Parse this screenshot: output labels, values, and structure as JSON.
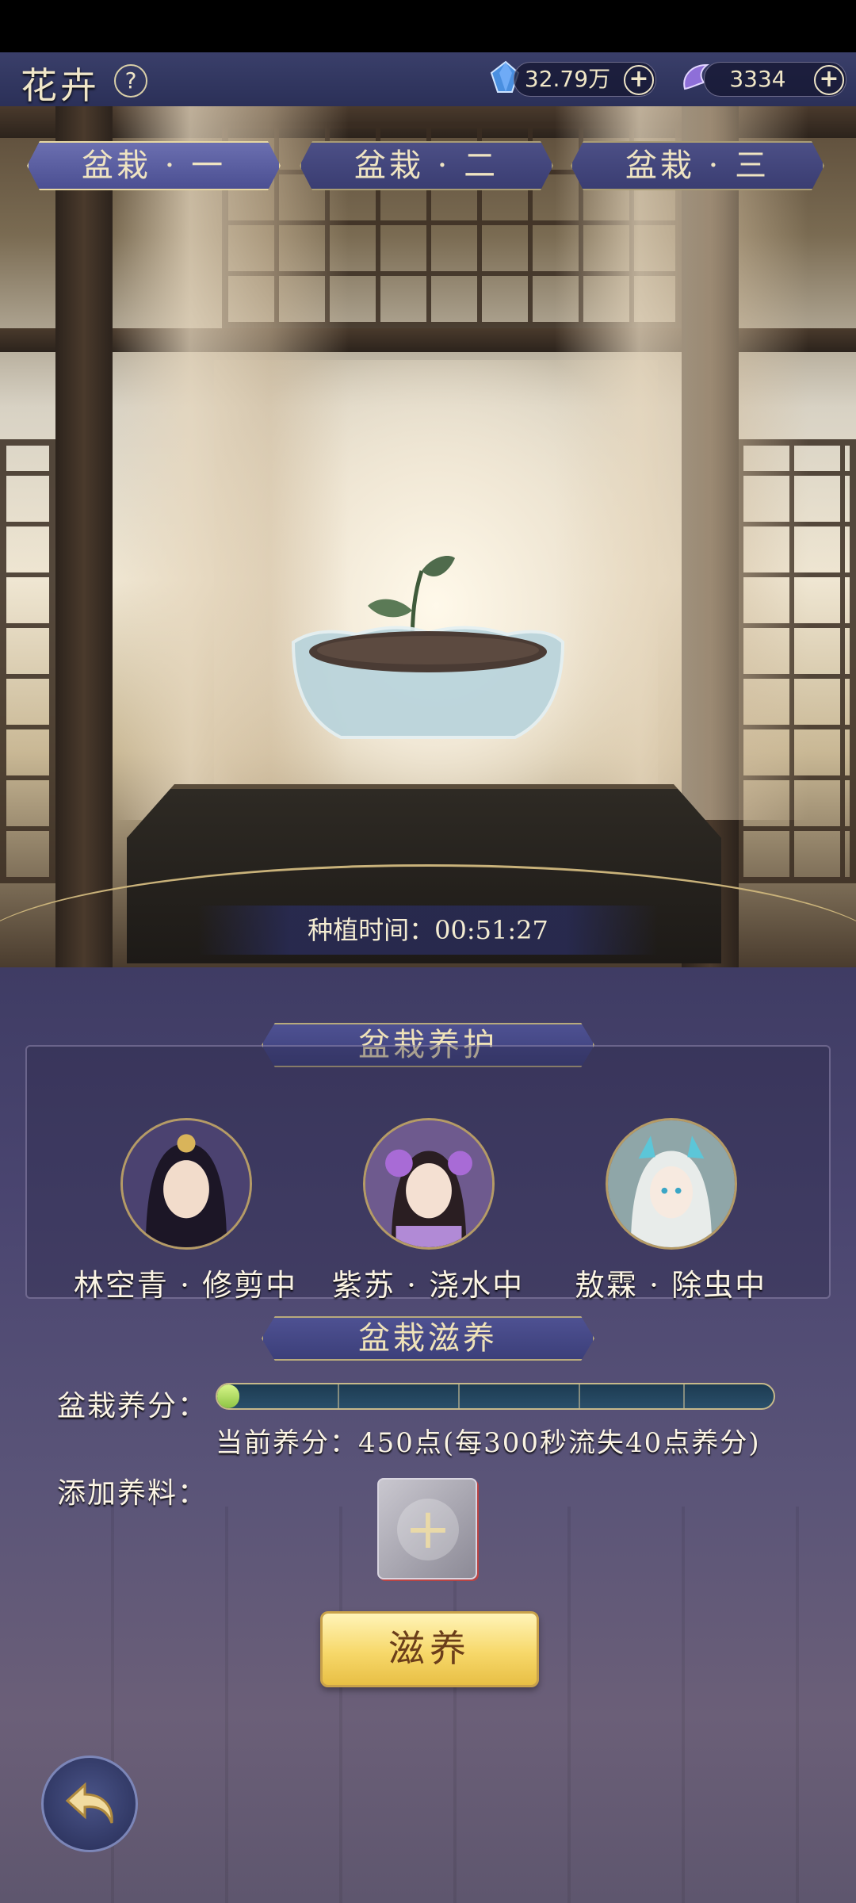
{
  "header": {
    "title": "花卉",
    "help_icon": "question-icon",
    "currency_1": {
      "icon": "blue-crystal-icon",
      "value": "32.79万"
    },
    "currency_2": {
      "icon": "purple-jade-icon",
      "value": "3334"
    }
  },
  "tabs": [
    {
      "label": "盆栽 · 一",
      "active": true
    },
    {
      "label": "盆栽 · 二",
      "active": false
    },
    {
      "label": "盆栽 · 三",
      "active": false
    }
  ],
  "scene": {
    "plant_time": "种植时间：00:51:27"
  },
  "care": {
    "title": "盆栽养护",
    "characters": [
      {
        "label": "林空青 · 修剪中"
      },
      {
        "label": "紫苏 · 浇水中"
      },
      {
        "label": "敖霖 · 除虫中"
      }
    ]
  },
  "nourish": {
    "title": "盆栽滋养",
    "score_label": "盆栽养分：",
    "score_fraction": 0.04,
    "score_text": "当前养分：450点(每300秒流失40点养分)",
    "add_label": "添加养料：",
    "button_label": "滋养"
  },
  "nav": {
    "back_icon": "back-arrow-icon"
  },
  "colors": {
    "accent_gold": "#e6d7a2",
    "button_gold": "#f7d86a",
    "panel_purple": "#4a4570",
    "bar_fill": "#b6e86a"
  }
}
